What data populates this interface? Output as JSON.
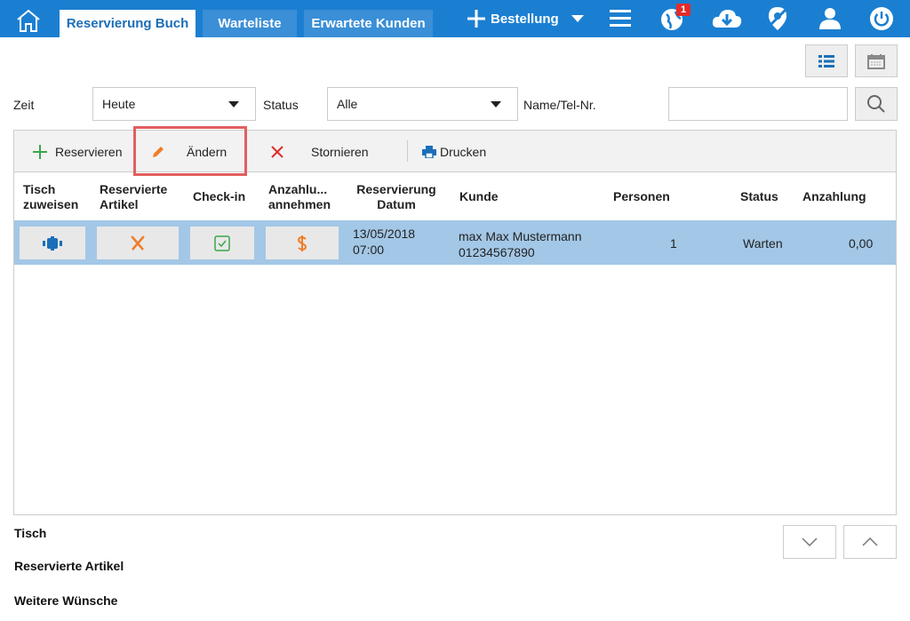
{
  "tabs": [
    "Reservierung Buch",
    "Warteliste",
    "Erwartete Kunden"
  ],
  "bestellung_label": "Bestellung",
  "notification_count": "1",
  "filters": {
    "zeit_label": "Zeit",
    "zeit_value": "Heute",
    "status_label": "Status",
    "status_value": "Alle",
    "name_label": "Name/Tel-Nr.",
    "search_value": ""
  },
  "toolbar": {
    "reservieren": "Reservieren",
    "aendern": "Ändern",
    "stornieren": "Stornieren",
    "drucken": "Drucken"
  },
  "columns": {
    "tisch": "Tisch zuweisen",
    "artikel": "Reservierte Artikel",
    "checkin": "Check-in",
    "anzahlung_annehmen": "Anzahlu... annehmen",
    "datum": "Reservierung Datum",
    "kunde": "Kunde",
    "personen": "Personen",
    "status": "Status",
    "anzahlung": "Anzahlung"
  },
  "rows": [
    {
      "datum": "13/05/2018",
      "zeit": "07:00",
      "kunde_name": "max Max Mustermann",
      "kunde_tel": "01234567890",
      "personen": "1",
      "status": "Warten",
      "anzahlung": "0,00"
    }
  ],
  "details": {
    "tisch": "Tisch",
    "artikel": "Reservierte Artikel",
    "wuensche": "Weitere Wünsche"
  },
  "colors": {
    "brand": "#1b7fd1",
    "selected_row": "#a3c7e6",
    "highlight": "#e35e5e",
    "green": "#3aa64a",
    "orange": "#f07d28",
    "red": "#e02a2a"
  }
}
